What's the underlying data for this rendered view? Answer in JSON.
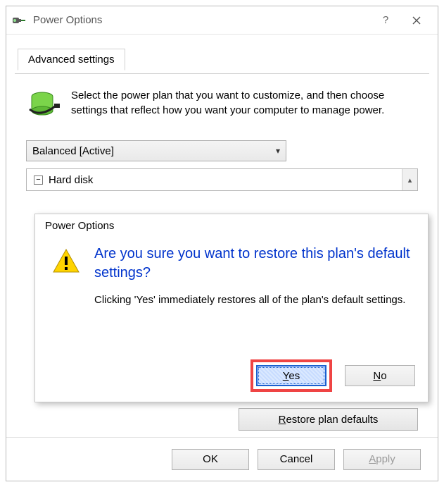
{
  "window": {
    "title": "Power Options"
  },
  "tab": {
    "label": "Advanced settings"
  },
  "intro": {
    "text": "Select the power plan that you want to customize, and then choose settings that reflect how you want your computer to manage power."
  },
  "plan_select": {
    "value": "Balanced [Active]"
  },
  "tree": {
    "root": "Hard disk"
  },
  "restore": {
    "prefix": "R",
    "rest": "estore plan defaults"
  },
  "buttons": {
    "ok": "OK",
    "cancel": "Cancel",
    "apply_prefix": "A",
    "apply_rest": "pply"
  },
  "confirm": {
    "title": "Power Options",
    "heading": "Are you sure you want to restore this plan's default settings?",
    "text": "Clicking 'Yes' immediately restores all of the plan's default settings.",
    "yes_prefix": "Y",
    "yes_rest": "es",
    "no_prefix": "N",
    "no_rest": "o"
  }
}
